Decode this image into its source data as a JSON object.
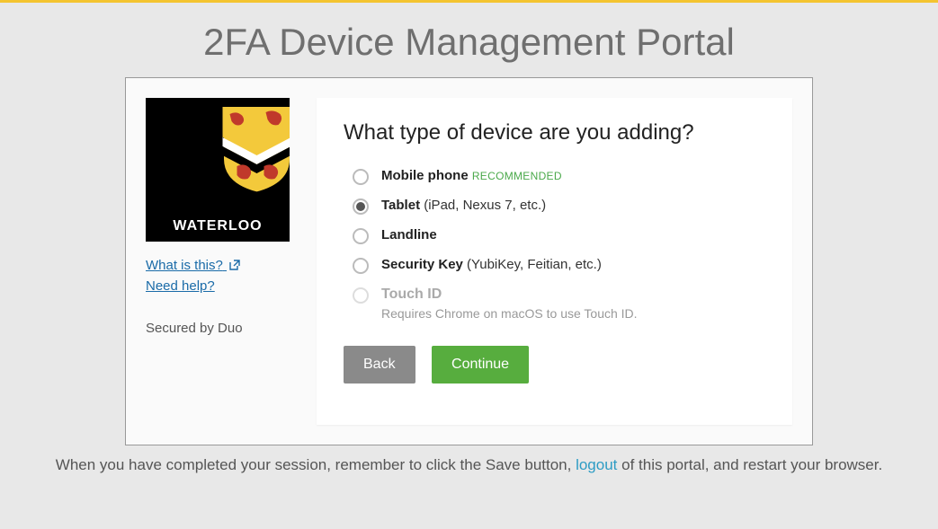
{
  "header": {
    "title": "2FA Device Management Portal"
  },
  "sidebar": {
    "logo_text": "WATERLOO",
    "links": {
      "what_is_this": "What is this?",
      "need_help": "Need help?"
    },
    "secured_by": "Secured by Duo"
  },
  "main": {
    "question": "What type of device are you adding?",
    "options": [
      {
        "label": "Mobile phone",
        "badge": "RECOMMENDED",
        "selected": false,
        "disabled": false
      },
      {
        "label": "Tablet",
        "sub": " (iPad, Nexus 7, etc.)",
        "selected": true,
        "disabled": false
      },
      {
        "label": "Landline",
        "selected": false,
        "disabled": false
      },
      {
        "label": "Security Key",
        "sub": " (YubiKey, Feitian, etc.)",
        "selected": false,
        "disabled": false
      },
      {
        "label": "Touch ID",
        "note": "Requires Chrome on macOS to use Touch ID.",
        "selected": false,
        "disabled": true
      }
    ],
    "buttons": {
      "back": "Back",
      "continue": "Continue"
    }
  },
  "footer": {
    "pre": "When you have completed your session, remember to click the Save button, ",
    "link": "logout",
    "post": " of this portal, and restart your browser."
  }
}
